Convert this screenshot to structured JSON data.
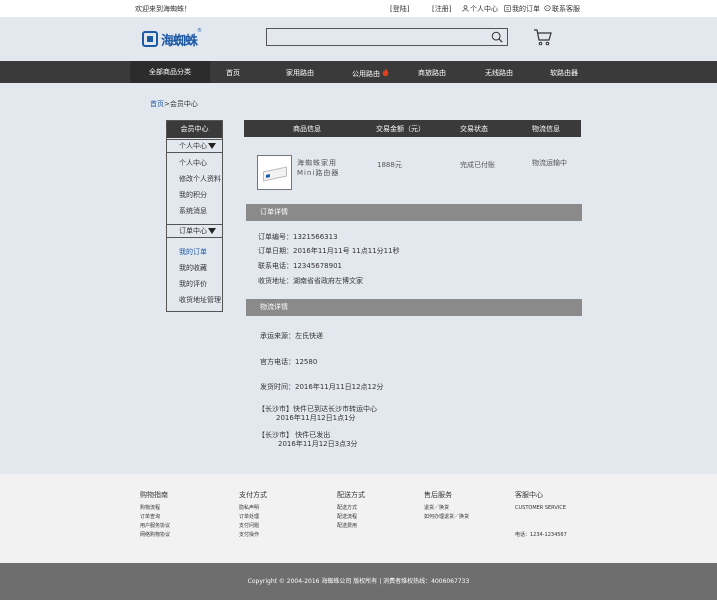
{
  "topbar": {
    "welcome": "欢迎来到海蜘蛛！",
    "login": "[登陆]",
    "register": "[注册]",
    "personal_center": "个人中心",
    "my_orders": "我的订单",
    "contact_service": "联系客服"
  },
  "header": {
    "logo_text": "海蜘蛛",
    "logo_reg": "®",
    "search_placeholder": ""
  },
  "nav": {
    "all_categories": "全部商品分类",
    "items": [
      "首页",
      "家用路由",
      "公用路由",
      "商旅路由",
      "无线路由",
      "软路由器"
    ]
  },
  "breadcrumb": {
    "home": "首页",
    "sep": ">",
    "current": "会员中心"
  },
  "sidebar": {
    "title": "会员中心",
    "group1": "个人中心",
    "group1_items": [
      "个人中心",
      "修改个人资料",
      "我的积分",
      "系统消息"
    ],
    "group2": "订单中心",
    "group2_items": [
      "我的订单",
      "我的收藏",
      "我的评价",
      "收货地址管理"
    ]
  },
  "order_table": {
    "headers": [
      "商品信息",
      "交易金额（元）",
      "交易状态",
      "物流信息"
    ],
    "product_name_line1": "海蜘蛛家用",
    "product_name_line2": "Mini路由器",
    "amount": "1888元",
    "status": "完成已付账",
    "logistics": "物流运输中"
  },
  "order_detail": {
    "title": "订单详情",
    "number": "订单编号：1321566313",
    "date": "订单日期：2016年11月11号     11点11分11秒",
    "phone": "联系电话：12345678901",
    "address": "收货地址：湖南省省政府左博文家"
  },
  "logistics_detail": {
    "title": "物流详情",
    "carrier": "承运来源：左氏快递",
    "official_phone": "官方电话：12580",
    "ship_time": "发货时间：2016年11月11日12点12分",
    "track1_title": "【长沙市】快件已到达长沙市转运中心",
    "track1_time": "2016年11月12日1点1分",
    "track2_title": "【长沙市】     快件已发出",
    "track2_time": "2016年11月12日3点3分"
  },
  "footer": {
    "cols": [
      {
        "title": "购物指南",
        "links": [
          "购物流程",
          "订单查询",
          "用户服务协议",
          "网络购物协议"
        ]
      },
      {
        "title": "支付方式",
        "links": [
          "隐私声明",
          "订单处理",
          "支付问题",
          "支付操作"
        ]
      },
      {
        "title": "配送方式",
        "links": [
          "配送方式",
          "配送流程",
          "配送费用"
        ]
      },
      {
        "title": "售后服务",
        "links": [
          "退货／换货",
          "如何办理退货／换货"
        ]
      },
      {
        "title": "客服中心",
        "links": [
          "CUSTOMER   SERVICE",
          "",
          "",
          "电话：1234-1234567"
        ]
      }
    ],
    "copyright": "Copyright ©  2004-2016   海蜘蛛公司 版权所有    |    消费者维权热线：4006067733"
  }
}
